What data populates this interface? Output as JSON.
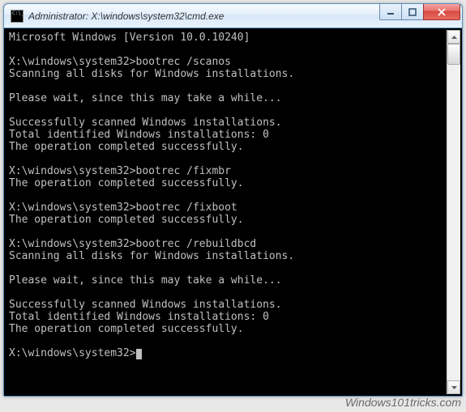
{
  "window": {
    "title": "Administrator: X:\\windows\\system32\\cmd.exe"
  },
  "terminal": {
    "lines": [
      "Microsoft Windows [Version 10.0.10240]",
      "",
      "X:\\windows\\system32>bootrec /scanos",
      "Scanning all disks for Windows installations.",
      "",
      "Please wait, since this may take a while...",
      "",
      "Successfully scanned Windows installations.",
      "Total identified Windows installations: 0",
      "The operation completed successfully.",
      "",
      "X:\\windows\\system32>bootrec /fixmbr",
      "The operation completed successfully.",
      "",
      "X:\\windows\\system32>bootrec /fixboot",
      "The operation completed successfully.",
      "",
      "X:\\windows\\system32>bootrec /rebuildbcd",
      "Scanning all disks for Windows installations.",
      "",
      "Please wait, since this may take a while...",
      "",
      "Successfully scanned Windows installations.",
      "Total identified Windows installations: 0",
      "The operation completed successfully.",
      "",
      "X:\\windows\\system32>"
    ]
  },
  "watermark": "Windows101tricks.com"
}
